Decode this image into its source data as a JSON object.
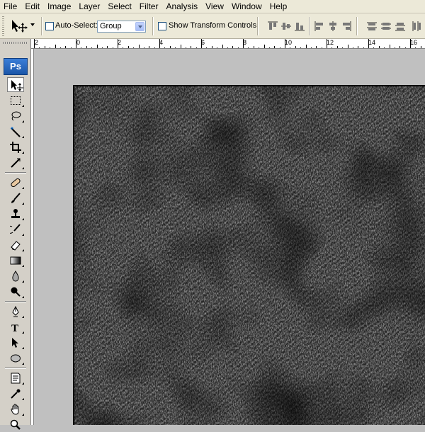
{
  "menu": [
    "File",
    "Edit",
    "Image",
    "Layer",
    "Select",
    "Filter",
    "Analysis",
    "View",
    "Window",
    "Help"
  ],
  "options": {
    "auto_select_label": "Auto-Select:",
    "auto_select_checked": false,
    "group_value": "Group",
    "show_transform_label": "Show Transform Controls",
    "show_transform_checked": false
  },
  "app": {
    "logo": "Ps"
  },
  "ruler": {
    "labels": [
      "2",
      "0",
      "2",
      "4",
      "6",
      "8",
      "10",
      "12",
      "14",
      "16"
    ]
  },
  "tools": [
    {
      "name": "move-tool",
      "icon": "move-icon",
      "active": true
    },
    {
      "name": "marquee-tool",
      "icon": "marquee-icon"
    },
    {
      "name": "lasso-tool",
      "icon": "lasso-icon"
    },
    {
      "name": "quick-selection-tool",
      "icon": "magic-wand-icon"
    },
    {
      "name": "crop-tool",
      "icon": "crop-icon"
    },
    {
      "name": "slice-tool",
      "icon": "slice-icon"
    },
    {
      "name": "healing-brush-tool",
      "icon": "bandage-icon"
    },
    {
      "name": "brush-tool",
      "icon": "brush-icon"
    },
    {
      "name": "clone-stamp-tool",
      "icon": "stamp-icon"
    },
    {
      "name": "history-brush-tool",
      "icon": "history-brush-icon"
    },
    {
      "name": "eraser-tool",
      "icon": "eraser-icon"
    },
    {
      "name": "gradient-tool",
      "icon": "gradient-icon"
    },
    {
      "name": "blur-tool",
      "icon": "drop-icon"
    },
    {
      "name": "dodge-tool",
      "icon": "dodge-icon"
    },
    {
      "name": "pen-tool",
      "icon": "pen-icon"
    },
    {
      "name": "type-tool",
      "icon": "type-icon",
      "glyph": "T"
    },
    {
      "name": "path-selection-tool",
      "icon": "arrow-icon"
    },
    {
      "name": "shape-tool",
      "icon": "ellipse-icon"
    },
    {
      "name": "notes-tool",
      "icon": "note-icon"
    },
    {
      "name": "eyedropper-tool",
      "icon": "eyedropper-icon"
    },
    {
      "name": "hand-tool",
      "icon": "hand-icon"
    },
    {
      "name": "zoom-tool",
      "icon": "zoom-icon"
    }
  ],
  "colors": {
    "ui_face": "#ece9d8",
    "toolbox": "#d4d0c8",
    "workspace": "#c0c0c0",
    "document_texture": "#2a2a2a",
    "ps_blue": "#1b56a8"
  }
}
